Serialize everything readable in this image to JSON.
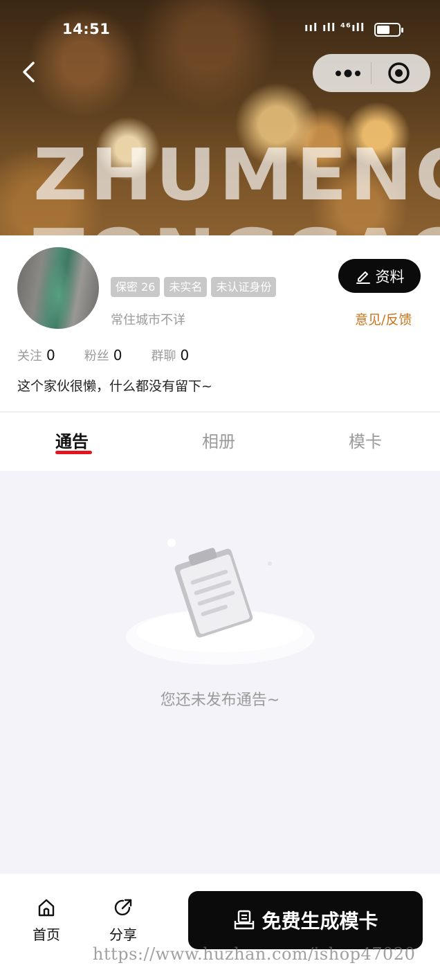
{
  "status_bar": {
    "time": "14:51",
    "signal": "ııl ıll ⁴⁶ıll"
  },
  "header": {
    "background_text_line1": "ZHUMENG",
    "background_text_line2": "TONGGAO"
  },
  "profile": {
    "tags": [
      "保密 26",
      "未实名",
      "未认证身份"
    ],
    "city": "常住城市不详",
    "edit_label": "资料",
    "feedback_label": "意见/反馈",
    "stats": [
      {
        "label": "关注",
        "value": "0"
      },
      {
        "label": "粉丝",
        "value": "0"
      },
      {
        "label": "群聊",
        "value": "0"
      }
    ],
    "bio": "这个家伙很懒，什么都没有留下~"
  },
  "tabs": [
    {
      "label": "通告",
      "active": true
    },
    {
      "label": "相册",
      "active": false
    },
    {
      "label": "模卡",
      "active": false
    }
  ],
  "empty_state": {
    "text": "您还未发布通告~"
  },
  "bottom_nav": {
    "home_label": "首页",
    "share_label": "分享",
    "generate_label": "免费生成模卡"
  },
  "watermark": "https://www.huzhan.com/ishop47020",
  "colors": {
    "accent_red": "#e4151f",
    "feedback_orange": "#c8741e",
    "button_black": "#0b0b0b"
  }
}
